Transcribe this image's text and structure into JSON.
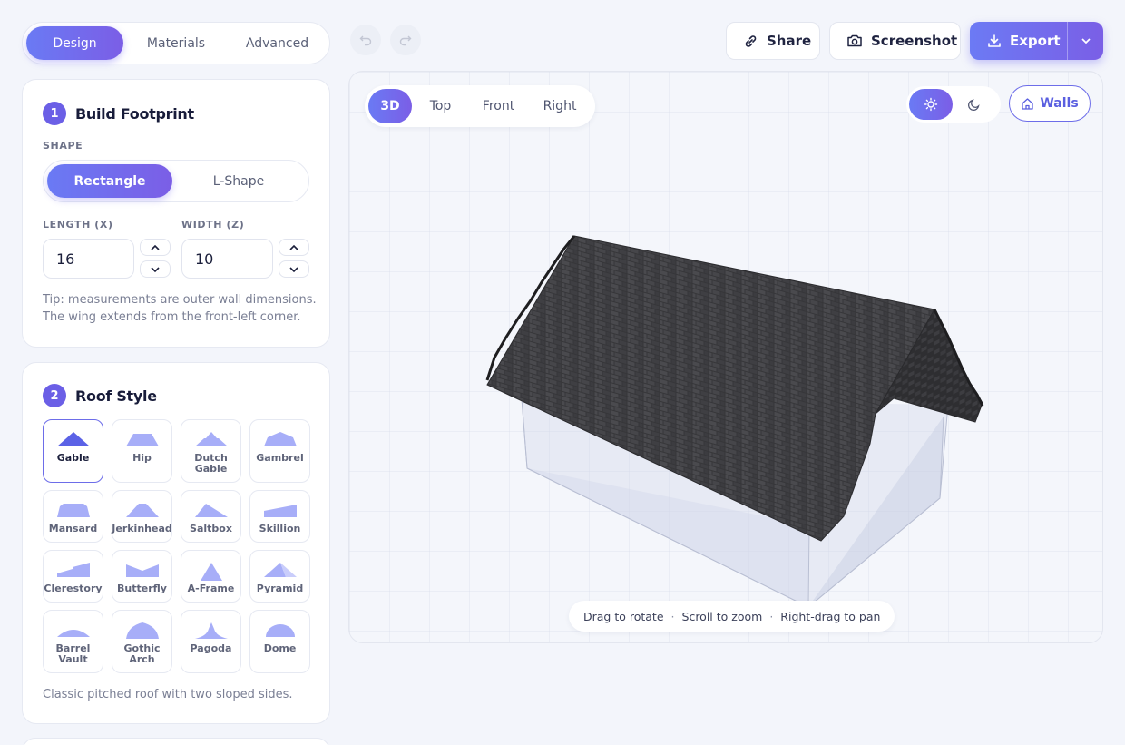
{
  "top_tabs": [
    {
      "label": "Design",
      "active": true
    },
    {
      "label": "Materials",
      "active": false
    },
    {
      "label": "Advanced",
      "active": false
    }
  ],
  "toolbar": {
    "share_label": "Share",
    "screenshot_label": "Screenshot",
    "export_label": "Export"
  },
  "footprint": {
    "step": "1",
    "title": "Build Footprint",
    "shape_label": "SHAPE",
    "shapes": [
      {
        "label": "Rectangle",
        "active": true
      },
      {
        "label": "L-Shape",
        "active": false
      }
    ],
    "length_label": "LENGTH (X)",
    "length_value": "16",
    "width_label": "WIDTH (Z)",
    "width_value": "10",
    "tip_line1": "Tip: measurements are outer wall dimensions.",
    "tip_line2": "The wing extends from the front-left corner."
  },
  "roof": {
    "step": "2",
    "title": "Roof Style",
    "styles": [
      {
        "name": "Gable",
        "active": true
      },
      {
        "name": "Hip"
      },
      {
        "name": "Dutch Gable"
      },
      {
        "name": "Gambrel"
      },
      {
        "name": "Mansard"
      },
      {
        "name": "Jerkinhead"
      },
      {
        "name": "Saltbox"
      },
      {
        "name": "Skillion"
      },
      {
        "name": "Clerestory"
      },
      {
        "name": "Butterfly"
      },
      {
        "name": "A-Frame"
      },
      {
        "name": "Pyramid"
      },
      {
        "name": "Barrel Vault"
      },
      {
        "name": "Gothic Arch"
      },
      {
        "name": "Pagoda"
      },
      {
        "name": "Dome"
      }
    ],
    "description": "Classic pitched roof with two sloped sides."
  },
  "viewport": {
    "views": [
      {
        "label": "3D",
        "active": true
      },
      {
        "label": "Top"
      },
      {
        "label": "Front"
      },
      {
        "label": "Right"
      }
    ],
    "theme": "light",
    "walls_label": "Walls",
    "hint_rotate": "Drag to rotate",
    "hint_zoom": "Scroll to zoom",
    "hint_pan": "Right-drag to pan",
    "roof_color": "#3a3a3d"
  },
  "colors": {
    "accent": "#6b5fe6",
    "accent_light": "#a7aef8"
  }
}
